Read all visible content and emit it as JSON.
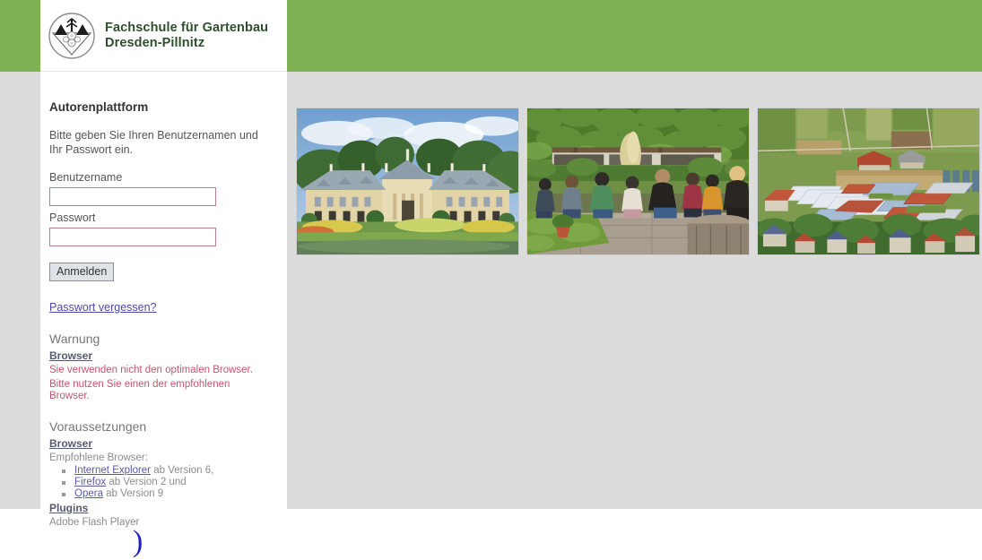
{
  "header": {
    "logo_icon": "school-crest-icon",
    "title_line1": "Fachschule für Gartenbau",
    "title_line2": "Dresden-Pillnitz",
    "accent_green": "#7fb255"
  },
  "login": {
    "panel_title": "Autorenplattform",
    "intro": "Bitte geben Sie Ihren Benutzernamen und Ihr Passwort ein.",
    "username_label": "Benutzername",
    "username_value": "",
    "username_placeholder": "",
    "password_label": "Passwort",
    "password_value": "",
    "password_placeholder": "",
    "submit_label": "Anmelden",
    "forgot_label": "Passwort vergessen?",
    "input_border_color": "#b2808f"
  },
  "warning": {
    "heading": "Warnung",
    "subheading": "Browser",
    "line1": "Sie verwenden nicht den optimalen Browser.",
    "line2": "Bitte nutzen Sie einen der empfohlenen Browser.",
    "color": "#c2566e"
  },
  "requirements": {
    "heading": "Voraussetzungen",
    "browser_subheading": "Browser",
    "recommended_intro": "Empfohlene Browser:",
    "browsers": [
      {
        "name": "Internet Explorer",
        "version": " ab Version 6,"
      },
      {
        "name": "Firefox",
        "version": " ab Version 2 und"
      },
      {
        "name": "Opera",
        "version": " ab Version 9"
      }
    ],
    "plugins_subheading": "Plugins",
    "plugins_text": "Adobe Flash Player"
  },
  "photos": [
    {
      "alt": "Schloss Pillnitz baroque palace with garden",
      "name": "photo-palace"
    },
    {
      "alt": "Students sitting outdoors in a garden courtyard",
      "name": "photo-students"
    },
    {
      "alt": "Aerial view of greenhouse nursery grounds",
      "name": "photo-greenhouses"
    }
  ],
  "footer": {
    "glyph": ")"
  }
}
